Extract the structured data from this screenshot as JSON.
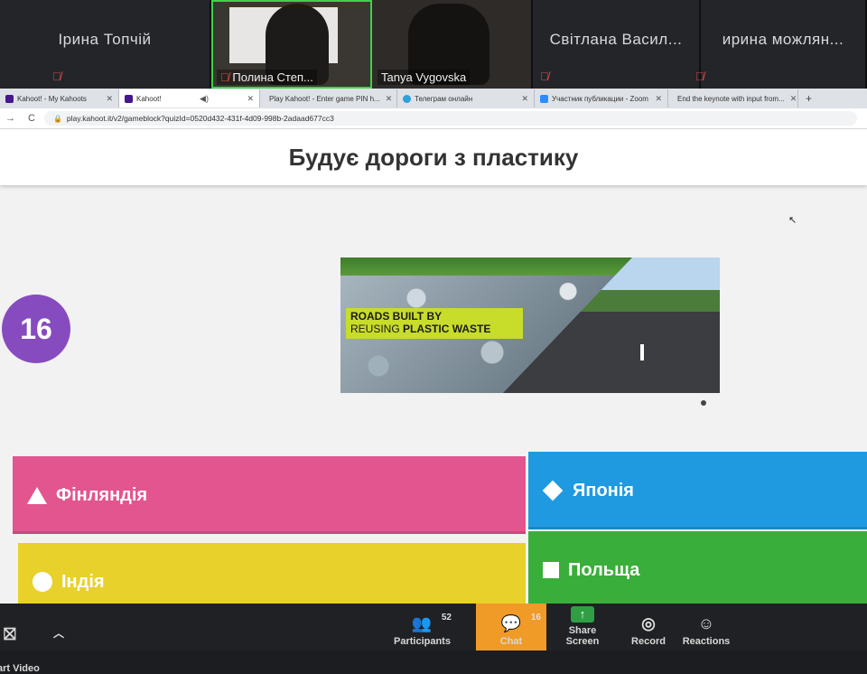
{
  "zoom_participants": [
    {
      "name": "Ірина Топчій",
      "muted": true
    },
    {
      "name": "Полина Степ...",
      "muted": true,
      "video": true
    },
    {
      "name": "Tanya Vygovska",
      "muted": false,
      "video": true
    },
    {
      "name": "Світлана Васил...",
      "muted": true
    },
    {
      "name": "ирина можлян...",
      "muted": true
    }
  ],
  "browser": {
    "tabs": [
      {
        "title": "Kahoot! - My Kahoots",
        "color": "#46178f"
      },
      {
        "title": "Kahoot!",
        "color": "#46178f",
        "active": true
      },
      {
        "title": "Play Kahoot! - Enter game PIN h...",
        "color": "#46178f"
      },
      {
        "title": "Телеграм онлайн",
        "color": "#2aa1da"
      },
      {
        "title": "Участник публикации - Zoom",
        "color": "#2d8cff"
      },
      {
        "title": "End the keynote with input from...",
        "color": "#e04070"
      }
    ],
    "new_tab": "+",
    "url": "play.kahoot.it/v2/gameblock?quizId=0520d432-431f-4d09-998b-2adaad677cc3"
  },
  "kahoot": {
    "question": "Будує дороги з пластику",
    "timer": "16",
    "image_caption_line1": "ROADS BUILT BY",
    "image_caption_line2_prefix": "REUSING",
    "image_caption_line2_bold": "PLASTIC WASTE",
    "answers": [
      {
        "shape": "triangle",
        "label": "Фінляндія",
        "color": "#e2558f"
      },
      {
        "shape": "diamond",
        "label": "Японія",
        "color": "#1f9ae0"
      },
      {
        "shape": "circle",
        "label": "Індія",
        "color": "#e8d12a"
      },
      {
        "shape": "square",
        "label": "Польща",
        "color": "#3aae3a"
      }
    ]
  },
  "zoom_controls": {
    "start_video": "Start Video",
    "participants_label": "Participants",
    "participants_count": "52",
    "chat_label": "Chat",
    "chat_count": "16",
    "share_label": "Share Screen",
    "record_label": "Record",
    "reactions_label": "Reactions"
  }
}
